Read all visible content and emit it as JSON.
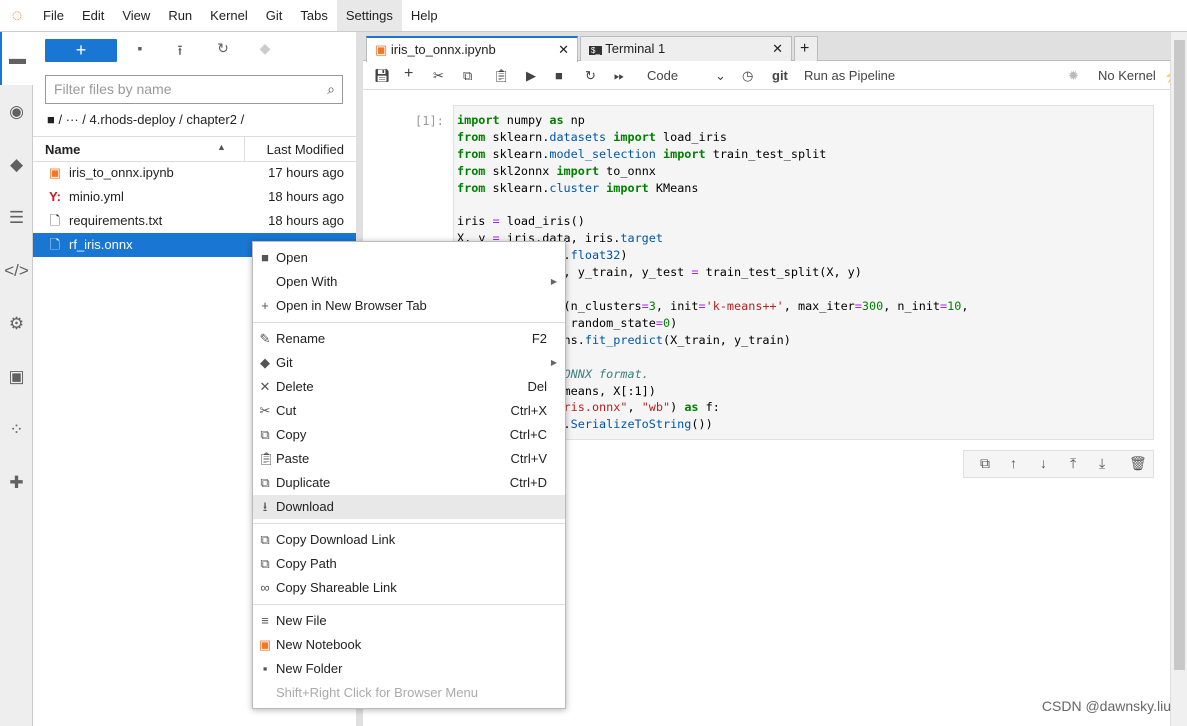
{
  "menubar": {
    "items": [
      "File",
      "Edit",
      "View",
      "Run",
      "Kernel",
      "Git",
      "Tabs",
      "Settings",
      "Help"
    ],
    "active": "Settings"
  },
  "browser": {
    "new_label": "+",
    "filter_placeholder": "Filter files by name",
    "breadcrumb": "/  ···  / 4.rhods-deploy / chapter2 /",
    "col_name": "Name",
    "col_modified": "Last Modified",
    "files": [
      {
        "name": "iris_to_onnx.ipynb",
        "modified": "17 hours ago",
        "icon": "notebook-icon"
      },
      {
        "name": "minio.yml",
        "modified": "18 hours ago",
        "icon": "yaml-icon"
      },
      {
        "name": "requirements.txt",
        "modified": "18 hours ago",
        "icon": "file-icon"
      },
      {
        "name": "rf_iris.onnx",
        "modified": "",
        "icon": "file-icon",
        "selected": true
      }
    ]
  },
  "tabs": [
    {
      "label": "iris_to_onnx.ipynb",
      "active": true
    },
    {
      "label": "Terminal 1"
    }
  ],
  "toolbar": {
    "cell_type": "Code",
    "git": "git",
    "pipeline": "Run as Pipeline",
    "kernel": "No Kernel"
  },
  "cell": {
    "prompt": "[1]:"
  },
  "context_menu": [
    {
      "label": "Open",
      "icon": "folder-icon"
    },
    {
      "label": "Open With",
      "submenu": true
    },
    {
      "label": "Open in New Browser Tab",
      "icon": "plus-icon"
    },
    {
      "sep": true
    },
    {
      "label": "Rename",
      "icon": "pencil-icon",
      "shortcut": "F2"
    },
    {
      "label": "Git",
      "icon": "git-icon",
      "submenu": true
    },
    {
      "label": "Delete",
      "icon": "close-icon",
      "shortcut": "Del"
    },
    {
      "label": "Cut",
      "icon": "scissors-icon",
      "shortcut": "Ctrl+X"
    },
    {
      "label": "Copy",
      "icon": "copy-icon",
      "shortcut": "Ctrl+C"
    },
    {
      "label": "Paste",
      "icon": "paste-icon",
      "shortcut": "Ctrl+V"
    },
    {
      "label": "Duplicate",
      "icon": "copy-icon",
      "shortcut": "Ctrl+D"
    },
    {
      "label": "Download",
      "icon": "download-icon",
      "hover": true
    },
    {
      "sep": true
    },
    {
      "label": "Copy Download Link",
      "icon": "copy-icon"
    },
    {
      "label": "Copy Path",
      "icon": "copy-icon"
    },
    {
      "label": "Copy Shareable Link",
      "icon": "link-icon"
    },
    {
      "sep": true
    },
    {
      "label": "New File",
      "icon": "file-icon"
    },
    {
      "label": "New Notebook",
      "icon": "notebook-icon"
    },
    {
      "label": "New Folder",
      "icon": "new-folder-icon"
    },
    {
      "label": "Shift+Right Click for Browser Menu",
      "disabled": true
    }
  ],
  "watermark": "CSDN @dawnsky.liu",
  "colors": {
    "accent": "#1976d2",
    "jupyter_orange": "#f37726"
  }
}
